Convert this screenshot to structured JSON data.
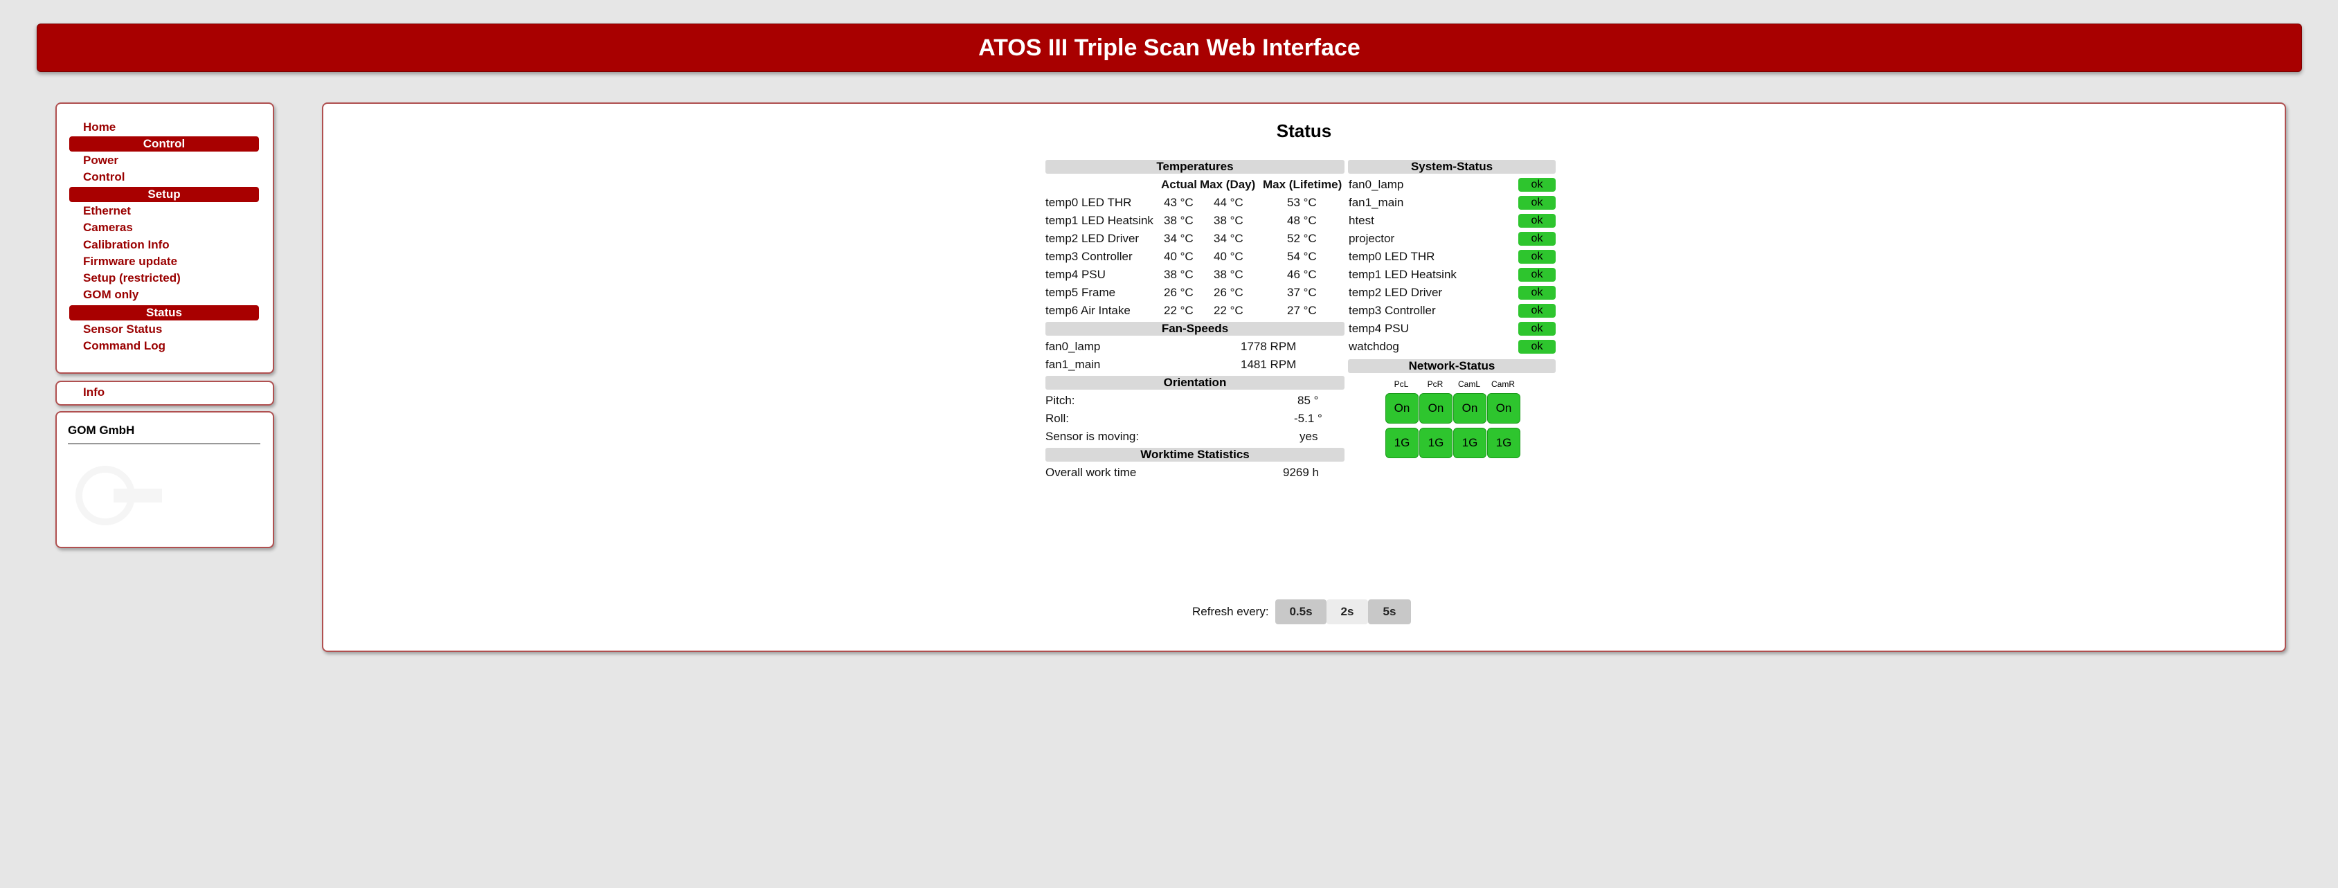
{
  "header": {
    "title": "ATOS III Triple Scan Web Interface"
  },
  "nav": {
    "home": "Home",
    "control_head": "Control",
    "power": "Power",
    "control": "Control",
    "setup_head": "Setup",
    "ethernet": "Ethernet",
    "cameras": "Cameras",
    "calibration_info": "Calibration Info",
    "firmware_update": "Firmware update",
    "setup_restricted": "Setup (restricted)",
    "gom_only": "GOM only",
    "status_head": "Status",
    "sensor_status": "Sensor Status",
    "command_log": "Command Log"
  },
  "info": {
    "label": "Info"
  },
  "company": {
    "name": "GOM GmbH"
  },
  "status": {
    "title": "Status",
    "temperatures": {
      "heading": "Temperatures",
      "columns": [
        "Actual",
        "Max (Day)",
        "Max (Lifetime)"
      ],
      "rows": [
        {
          "name": "temp0 LED THR",
          "actual": "43 °C",
          "max_day": "44 °C",
          "max_life": "53 °C"
        },
        {
          "name": "temp1 LED Heatsink",
          "actual": "38 °C",
          "max_day": "38 °C",
          "max_life": "48 °C"
        },
        {
          "name": "temp2 LED Driver",
          "actual": "34 °C",
          "max_day": "34 °C",
          "max_life": "52 °C"
        },
        {
          "name": "temp3 Controller",
          "actual": "40 °C",
          "max_day": "40 °C",
          "max_life": "54 °C"
        },
        {
          "name": "temp4 PSU",
          "actual": "38 °C",
          "max_day": "38 °C",
          "max_life": "46 °C"
        },
        {
          "name": "temp5 Frame",
          "actual": "26 °C",
          "max_day": "26 °C",
          "max_life": "37 °C"
        },
        {
          "name": "temp6 Air Intake",
          "actual": "22 °C",
          "max_day": "22 °C",
          "max_life": "27 °C"
        }
      ]
    },
    "fan_speeds": {
      "heading": "Fan-Speeds",
      "rows": [
        {
          "name": "fan0_lamp",
          "value": "1778 RPM"
        },
        {
          "name": "fan1_main",
          "value": "1481 RPM"
        }
      ]
    },
    "orientation": {
      "heading": "Orientation",
      "rows": [
        {
          "name": "Pitch:",
          "value": "85 °"
        },
        {
          "name": "Roll:",
          "value": "-5.1 °"
        },
        {
          "name": "Sensor is moving:",
          "value": "yes"
        }
      ]
    },
    "worktime": {
      "heading": "Worktime Statistics",
      "rows": [
        {
          "name": "Overall work time",
          "value": "9269 h"
        }
      ]
    },
    "system_status": {
      "heading": "System-Status",
      "rows": [
        {
          "name": "fan0_lamp",
          "state": "ok"
        },
        {
          "name": "fan1_main",
          "state": "ok"
        },
        {
          "name": "htest",
          "state": "ok"
        },
        {
          "name": "projector",
          "state": "ok"
        },
        {
          "name": "temp0 LED THR",
          "state": "ok"
        },
        {
          "name": "temp1 LED Heatsink",
          "state": "ok"
        },
        {
          "name": "temp2 LED Driver",
          "state": "ok"
        },
        {
          "name": "temp3 Controller",
          "state": "ok"
        },
        {
          "name": "temp4 PSU",
          "state": "ok"
        },
        {
          "name": "watchdog",
          "state": "ok"
        }
      ]
    },
    "network_status": {
      "heading": "Network-Status",
      "columns": [
        "PcL",
        "PcR",
        "CamL",
        "CamR"
      ],
      "link": [
        "On",
        "On",
        "On",
        "On"
      ],
      "speed": [
        "1G",
        "1G",
        "1G",
        "1G"
      ]
    },
    "refresh": {
      "label": "Refresh every:",
      "options": [
        "0.5s",
        "2s",
        "5s"
      ],
      "selected": "2s"
    }
  },
  "colors": {
    "brand": "#a80000",
    "ok": "#2ec52e",
    "section": "#d9d9d9"
  }
}
